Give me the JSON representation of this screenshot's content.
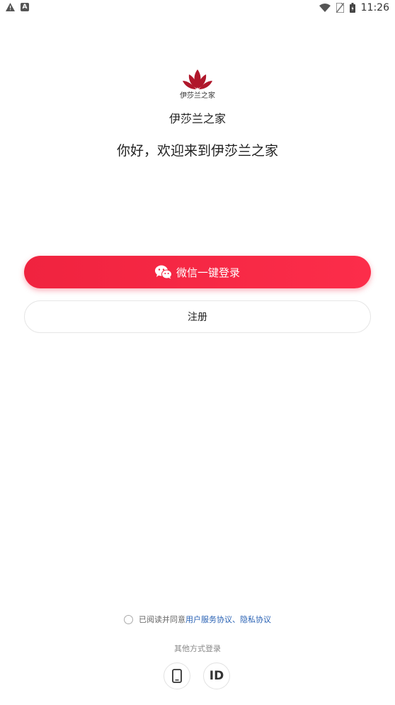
{
  "status_bar": {
    "time": "11:26",
    "left_icons": [
      "warning-icon",
      "a-notification-icon"
    ],
    "right_icons": [
      "wifi-icon",
      "no-sim-icon",
      "battery-icon"
    ]
  },
  "logo": {
    "text": "伊莎兰之家",
    "color": "#b0172b"
  },
  "app_name": "伊莎兰之家",
  "welcome": "你好，欢迎来到伊莎兰之家",
  "buttons": {
    "wechat_login": "微信一键登录",
    "register": "注册"
  },
  "agreement": {
    "prefix": "已阅读并同意",
    "user_agreement": "用户服务协议",
    "separator": "、",
    "privacy_policy": "隐私协议",
    "checked": false
  },
  "other_login": {
    "label": "其他方式登录",
    "phone_icon": "phone-icon",
    "id_label": "ID"
  },
  "colors": {
    "primary": "#f0233f",
    "link": "#2a62b4"
  }
}
